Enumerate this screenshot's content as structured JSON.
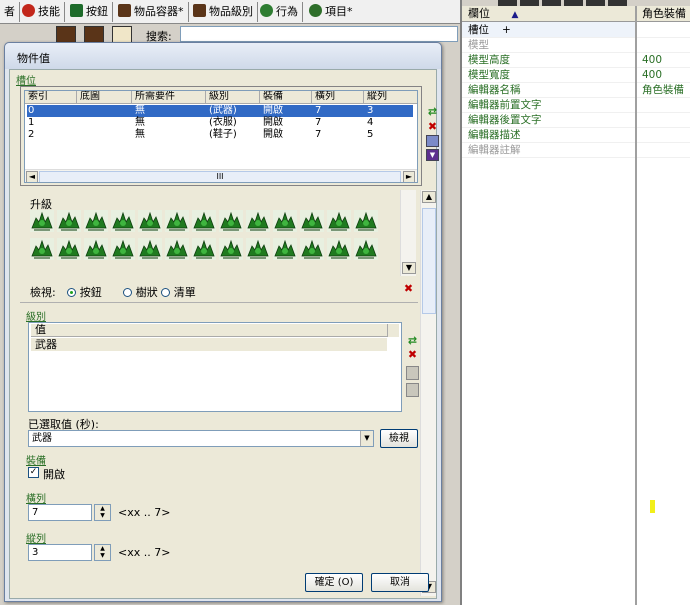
{
  "tabs": [
    {
      "label": "者"
    },
    {
      "label": "技能",
      "icon": "ability-icon",
      "color": "#c2261a"
    },
    {
      "label": "按鈕",
      "icon": "button-icon",
      "color": "#1d6b2b"
    },
    {
      "label": "物品容器*",
      "icon": "item-container-icon",
      "color": "#5a3418"
    },
    {
      "label": "物品級別",
      "icon": "item-class-icon",
      "color": "#5a3418"
    },
    {
      "label": "行為",
      "icon": "behavior-icon",
      "color": "#2e7d32"
    },
    {
      "label": "項目*",
      "icon": "item-icon",
      "color": "#2e6e2a"
    }
  ],
  "toolbar": {
    "search_label": "搜索:"
  },
  "properties": {
    "header": {
      "field": "欄位",
      "sort_indicator": "▲",
      "value": "角色裝備"
    },
    "rows": [
      {
        "name": "槽位",
        "value": "",
        "suffix": "+",
        "style": "normal"
      },
      {
        "name": "模型",
        "value": "",
        "style": "gray"
      },
      {
        "name": "模型高度",
        "value": "400",
        "style": "green"
      },
      {
        "name": "模型寬度",
        "value": "400",
        "style": "green"
      },
      {
        "name": "編輯器名稱",
        "value": "角色裝備",
        "style": "green"
      },
      {
        "name": "編輯器前置文字",
        "value": "",
        "style": "green"
      },
      {
        "name": "編輯器後置文字",
        "value": "",
        "style": "green"
      },
      {
        "name": "編輯器描述",
        "value": "",
        "style": "green"
      },
      {
        "name": "編輯器註解",
        "value": "",
        "style": "gray"
      }
    ]
  },
  "dialog": {
    "title": "物件值",
    "field_link": "槽位",
    "grid": {
      "columns": [
        "索引",
        "底圖",
        "所需要件",
        "級別",
        "裝備",
        "橫列",
        "縱列"
      ],
      "rows": [
        [
          "0",
          "",
          "無",
          "(武器)",
          "開啟",
          "7",
          "3"
        ],
        [
          "1",
          "",
          "無",
          "(衣服)",
          "開啟",
          "7",
          "4"
        ],
        [
          "2",
          "",
          "無",
          "(鞋子)",
          "開啟",
          "7",
          "5"
        ]
      ],
      "selected_row": 0,
      "hscroll_thumb": "III"
    },
    "upgrade_label": "升級",
    "view": {
      "label": "檢視:",
      "options": [
        "按鈕",
        "樹狀",
        "清單"
      ],
      "selected": "按鈕"
    },
    "class_link": "級別",
    "class_list": {
      "header": "值",
      "items": [
        "武器"
      ]
    },
    "selected_value_label": "已選取值 (秒):",
    "selected_value": "武器",
    "view_button": "檢視",
    "equip_link": "裝備",
    "equip_checkbox": {
      "label": "開啟",
      "checked": true
    },
    "row_link": "橫列",
    "row_value": "7",
    "row_range": "<xx .. 7>",
    "col_link": "縱列",
    "col_value": "3",
    "col_range": "<xx .. 7>",
    "ok_button": "確定 (O)",
    "cancel_button": "取消"
  },
  "colors": {
    "link_green": "#2a6f26",
    "selection_blue": "#316ac5",
    "highlight_yellow": "#f2ef1a"
  }
}
